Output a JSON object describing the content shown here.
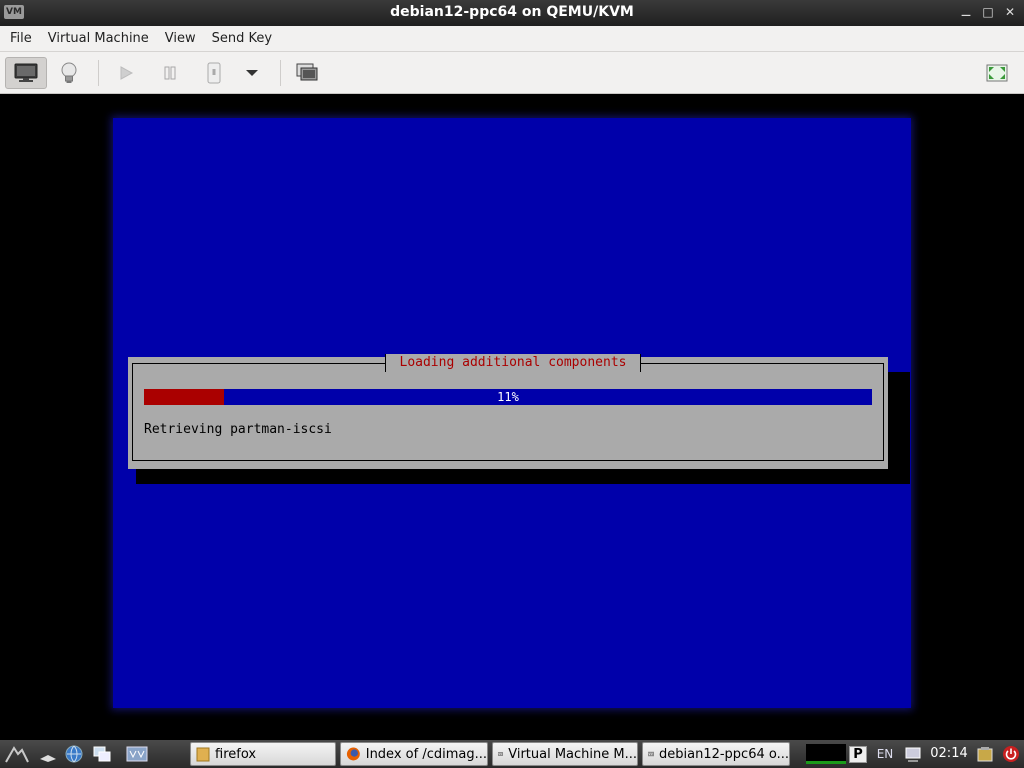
{
  "window": {
    "title": "debian12-ppc64 on QEMU/KVM",
    "icon_label": "VM",
    "controls": [
      "minimize-icon",
      "maximize-icon",
      "close-icon"
    ]
  },
  "menubar": {
    "items": [
      "File",
      "Virtual Machine",
      "View",
      "Send Key"
    ]
  },
  "toolbar": {
    "buttons": [
      {
        "name": "show-console",
        "icon": "monitor-icon",
        "active": true
      },
      {
        "name": "show-details",
        "icon": "lightbulb-icon"
      },
      {
        "name": "run",
        "icon": "play-icon",
        "enabled": false
      },
      {
        "name": "pause",
        "icon": "pause-icon",
        "enabled": false
      },
      {
        "name": "shutdown",
        "icon": "power-switch-icon",
        "enabled": false
      },
      {
        "name": "shutdown-menu",
        "icon": "chevron-down-icon"
      },
      {
        "name": "snapshots",
        "icon": "snapshot-icon"
      },
      {
        "name": "fullscreen",
        "icon": "fullscreen-icon"
      }
    ]
  },
  "installer": {
    "dialog_title": "Loading additional components",
    "progress_label": "11%",
    "progress": 0.11,
    "status": "Retrieving partman-iscsi",
    "colors": {
      "background": "#0000aa",
      "dialog": "#aaaaaa",
      "title": "#aa0000",
      "fill": "#aa0000"
    }
  },
  "taskbar": {
    "tasks": [
      {
        "label": "firefox",
        "icon": "folder-icon"
      },
      {
        "label": "Index of /cdimag...",
        "icon": "firefox-icon"
      },
      {
        "label": "Virtual Machine M...",
        "icon": "virt-manager-icon"
      },
      {
        "label": "debian12-ppc64 o...",
        "icon": "virt-manager-icon"
      }
    ],
    "tray": {
      "lang": "EN",
      "clock": "02:14",
      "plugin_label": "P"
    }
  }
}
